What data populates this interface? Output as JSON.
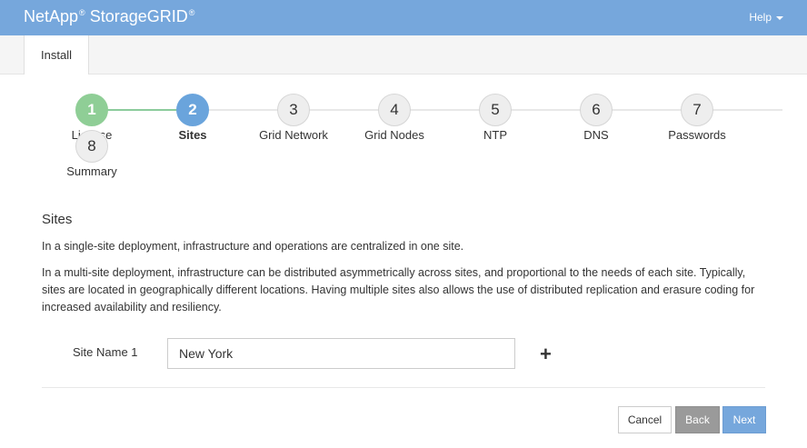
{
  "header": {
    "brand_name": "NetApp",
    "brand_reg": "®",
    "product_name": "StorageGRID",
    "product_reg": "®",
    "help_label": "Help"
  },
  "tabs": [
    {
      "label": "Install"
    }
  ],
  "steps": [
    {
      "number": "1",
      "label": "License",
      "state": "done"
    },
    {
      "number": "2",
      "label": "Sites",
      "state": "active"
    },
    {
      "number": "3",
      "label": "Grid Network",
      "state": "pending"
    },
    {
      "number": "4",
      "label": "Grid Nodes",
      "state": "pending"
    },
    {
      "number": "5",
      "label": "NTP",
      "state": "pending"
    },
    {
      "number": "6",
      "label": "DNS",
      "state": "pending"
    },
    {
      "number": "7",
      "label": "Passwords",
      "state": "pending"
    },
    {
      "number": "8",
      "label": "Summary",
      "state": "pending"
    }
  ],
  "section": {
    "title": "Sites",
    "paragraphs": [
      "In a single-site deployment, infrastructure and operations are centralized in one site.",
      "In a multi-site deployment, infrastructure can be distributed asymmetrically across sites, and proportional to the needs of each site. Typically, sites are located in geographically different locations. Having multiple sites also allows the use of distributed replication and erasure coding for increased availability and resiliency."
    ]
  },
  "form": {
    "site_label": "Site Name 1",
    "site_value": "New York",
    "add_icon": "+"
  },
  "actions": {
    "cancel": "Cancel",
    "back": "Back",
    "next": "Next"
  },
  "colors": {
    "header_bg": "#76a7dc",
    "step_done": "#8fce96",
    "step_active": "#6aa4dc",
    "back_button": "#9a9a9a",
    "next_button": "#76a7dc"
  }
}
